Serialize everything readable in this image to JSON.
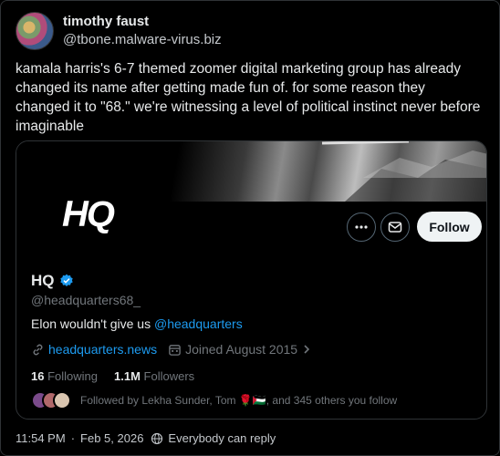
{
  "tweet": {
    "author_name": "timothy faust",
    "author_handle": "@tbone.malware-virus.biz",
    "text": "kamala harris's 6-7 themed zoomer digital marketing group has already changed its name after getting made fun of. for some reason they changed it to \"68.\" we're witnessing a level of political instinct never before imaginable"
  },
  "card": {
    "avatar_text": "HQ",
    "follow_label": "Follow",
    "more_icon": "more-icon",
    "message_icon": "envelope-icon",
    "name": "HQ",
    "verified_icon": "verified-badge-icon",
    "handle": "@headquarters68_",
    "bio_prefix": "Elon wouldn't give us ",
    "bio_mention": "@headquarters",
    "website": "headquarters.news",
    "joined": "Joined August 2015",
    "following_count": "16",
    "following_label": "Following",
    "followers_count": "1.1M",
    "followers_label": "Followers",
    "followed_by": "Followed by Lekha Sunder, Tom 🌹🇵🇸, and 345 others you follow"
  },
  "footer": {
    "time": "11:54 PM",
    "date": "Feb 5, 2026",
    "reply_setting": "Everybody can reply"
  },
  "colors": {
    "background": "#000000",
    "link": "#1d9bf0",
    "verified": "#1d9bf0",
    "follow_button_bg": "#eff3f4"
  }
}
